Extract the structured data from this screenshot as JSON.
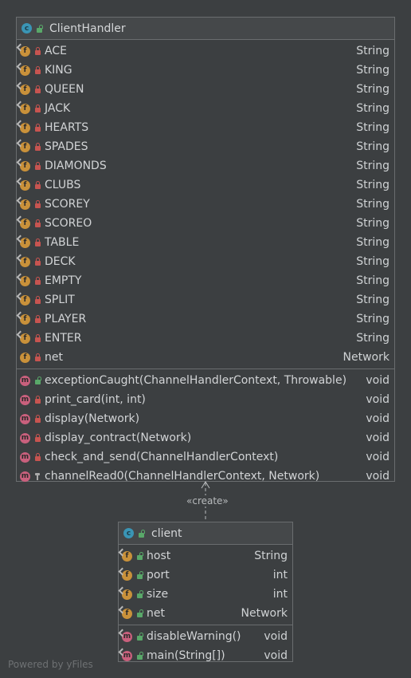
{
  "client_handler": {
    "title": "ClientHandler",
    "fields": [
      {
        "name": "ACE",
        "type": "String",
        "visibility": "private",
        "static": true
      },
      {
        "name": "KING",
        "type": "String",
        "visibility": "private",
        "static": true
      },
      {
        "name": "QUEEN",
        "type": "String",
        "visibility": "private",
        "static": true
      },
      {
        "name": "JACK",
        "type": "String",
        "visibility": "private",
        "static": true
      },
      {
        "name": "HEARTS",
        "type": "String",
        "visibility": "private",
        "static": true
      },
      {
        "name": "SPADES",
        "type": "String",
        "visibility": "private",
        "static": true
      },
      {
        "name": "DIAMONDS",
        "type": "String",
        "visibility": "private",
        "static": true
      },
      {
        "name": "CLUBS",
        "type": "String",
        "visibility": "private",
        "static": true
      },
      {
        "name": "SCOREY",
        "type": "String",
        "visibility": "private",
        "static": true
      },
      {
        "name": "SCOREO",
        "type": "String",
        "visibility": "private",
        "static": true
      },
      {
        "name": "TABLE",
        "type": "String",
        "visibility": "private",
        "static": true
      },
      {
        "name": "DECK",
        "type": "String",
        "visibility": "private",
        "static": true
      },
      {
        "name": "EMPTY",
        "type": "String",
        "visibility": "private",
        "static": true
      },
      {
        "name": "SPLIT",
        "type": "String",
        "visibility": "private",
        "static": true
      },
      {
        "name": "PLAYER",
        "type": "String",
        "visibility": "private",
        "static": true
      },
      {
        "name": "ENTER",
        "type": "String",
        "visibility": "private",
        "static": true
      },
      {
        "name": "net",
        "type": "Network",
        "visibility": "private",
        "static": false
      }
    ],
    "methods": [
      {
        "name": "exceptionCaught(ChannelHandlerContext, Throwable)",
        "type": "void",
        "visibility": "public"
      },
      {
        "name": "print_card(int, int)",
        "type": "void",
        "visibility": "private"
      },
      {
        "name": "display(Network)",
        "type": "void",
        "visibility": "private"
      },
      {
        "name": "display_contract(Network)",
        "type": "void",
        "visibility": "private"
      },
      {
        "name": "check_and_send(ChannelHandlerContext)",
        "type": "void",
        "visibility": "private"
      },
      {
        "name": "channelRead0(ChannelHandlerContext, Network)",
        "type": "void",
        "visibility": "protected"
      }
    ]
  },
  "client": {
    "title": "client",
    "fields": [
      {
        "name": "host",
        "type": "String",
        "visibility": "public",
        "static": true
      },
      {
        "name": "port",
        "type": "int",
        "visibility": "public",
        "static": true
      },
      {
        "name": "size",
        "type": "int",
        "visibility": "public",
        "static": true
      },
      {
        "name": "net",
        "type": "Network",
        "visibility": "public",
        "static": true
      }
    ],
    "methods": [
      {
        "name": "disableWarning()",
        "type": "void",
        "visibility": "public",
        "static": true
      },
      {
        "name": "main(String[])",
        "type": "void",
        "visibility": "public",
        "static": true
      }
    ]
  },
  "edge_label": "«create»",
  "footer": "Powered by yFiles",
  "colors": {
    "background": "#3c3f41",
    "border": "#6a6d6f",
    "field_icon": "#c9913a",
    "method_icon": "#c9607d",
    "class_icon": "#3a95b5",
    "private": "#c75450",
    "public": "#59a869"
  }
}
